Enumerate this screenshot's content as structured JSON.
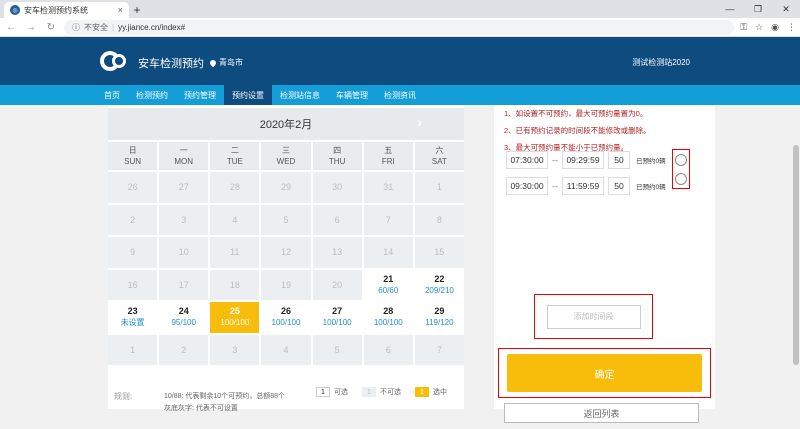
{
  "browser": {
    "tab_title": "安车检测预约系统",
    "tab_close": "×",
    "new_tab": "+",
    "security": "不安全",
    "url": "yy.jiance.cn/index#"
  },
  "header": {
    "site_title": "安车检测预约",
    "city": "青岛市",
    "station": "测试检测站2020"
  },
  "nav": [
    {
      "label": "首页"
    },
    {
      "label": "检测预约"
    },
    {
      "label": "预约管理"
    },
    {
      "label": "预约设置",
      "active": true
    },
    {
      "label": "检测站信息"
    },
    {
      "label": "车辆管理"
    },
    {
      "label": "检测资讯"
    }
  ],
  "calendar": {
    "month_title": "2020年2月",
    "next_arrow": "›",
    "weekdays": [
      {
        "cn": "日",
        "en": "SUN"
      },
      {
        "cn": "一",
        "en": "MON"
      },
      {
        "cn": "二",
        "en": "TUE"
      },
      {
        "cn": "三",
        "en": "WED"
      },
      {
        "cn": "四",
        "en": "THU"
      },
      {
        "cn": "五",
        "en": "FRI"
      },
      {
        "cn": "六",
        "en": "SAT"
      }
    ],
    "days": [
      {
        "d": "26",
        "s": "",
        "t": "other"
      },
      {
        "d": "27",
        "s": "",
        "t": "other"
      },
      {
        "d": "28",
        "s": "",
        "t": "other"
      },
      {
        "d": "29",
        "s": "",
        "t": "other"
      },
      {
        "d": "30",
        "s": "",
        "t": "other"
      },
      {
        "d": "31",
        "s": "",
        "t": "other"
      },
      {
        "d": "1",
        "s": "",
        "t": "other"
      },
      {
        "d": "2",
        "s": "",
        "t": "other"
      },
      {
        "d": "3",
        "s": "",
        "t": "other"
      },
      {
        "d": "4",
        "s": "",
        "t": "other"
      },
      {
        "d": "5",
        "s": "",
        "t": "other"
      },
      {
        "d": "6",
        "s": "",
        "t": "other"
      },
      {
        "d": "7",
        "s": "",
        "t": "other"
      },
      {
        "d": "8",
        "s": "",
        "t": "other"
      },
      {
        "d": "9",
        "s": "",
        "t": "other"
      },
      {
        "d": "10",
        "s": "",
        "t": "other"
      },
      {
        "d": "11",
        "s": "",
        "t": "other"
      },
      {
        "d": "12",
        "s": "",
        "t": "other"
      },
      {
        "d": "13",
        "s": "",
        "t": "other"
      },
      {
        "d": "14",
        "s": "",
        "t": "other"
      },
      {
        "d": "15",
        "s": "",
        "t": "other"
      },
      {
        "d": "16",
        "s": "",
        "t": "other"
      },
      {
        "d": "17",
        "s": "",
        "t": "other"
      },
      {
        "d": "18",
        "s": "",
        "t": "other"
      },
      {
        "d": "19",
        "s": "",
        "t": "other"
      },
      {
        "d": "20",
        "s": "",
        "t": "other"
      },
      {
        "d": "21",
        "s": "60/60",
        "t": "cur"
      },
      {
        "d": "22",
        "s": "209/210",
        "t": "cur"
      },
      {
        "d": "23",
        "s": "未设置",
        "t": "cur"
      },
      {
        "d": "24",
        "s": "95/100",
        "t": "cur"
      },
      {
        "d": "25",
        "s": "100/100",
        "t": "sel"
      },
      {
        "d": "26",
        "s": "100/100",
        "t": "cur"
      },
      {
        "d": "27",
        "s": "100/100",
        "t": "cur"
      },
      {
        "d": "28",
        "s": "100/100",
        "t": "cur"
      },
      {
        "d": "29",
        "s": "119/120",
        "t": "cur"
      },
      {
        "d": "1",
        "s": "",
        "t": "other"
      },
      {
        "d": "2",
        "s": "",
        "t": "other"
      },
      {
        "d": "3",
        "s": "",
        "t": "other"
      },
      {
        "d": "4",
        "s": "",
        "t": "other"
      },
      {
        "d": "5",
        "s": "",
        "t": "other"
      },
      {
        "d": "6",
        "s": "",
        "t": "other"
      },
      {
        "d": "7",
        "s": "",
        "t": "other"
      }
    ]
  },
  "legend": {
    "rule": "规则:",
    "line1": "10/88: 代表剩余10个可预约，总额88个",
    "line2": "灰底灰字: 代表不可设置",
    "items": [
      {
        "num": "1",
        "label": "可选",
        "style": "a"
      },
      {
        "num": "1",
        "label": "不可选",
        "style": "b"
      },
      {
        "num": "1",
        "label": "选中",
        "style": "c"
      }
    ]
  },
  "panel": {
    "notes": [
      "1、如设置不可预约，最大可预约量置为0。",
      "2、已有预约记录的时间段不能修改或删除。",
      "3、最大可预约量不能小于已预约量。"
    ],
    "slots": [
      {
        "start": "07:30:00",
        "end": "09:29:59",
        "max": "50",
        "booked": "已预约0辆"
      },
      {
        "start": "09:30:00",
        "end": "11:59:59",
        "max": "50",
        "booked": "已预约0辆"
      }
    ],
    "range_sep": "--",
    "add_label": "添加时间段",
    "confirm_label": "确定",
    "back_label": "返回列表"
  }
}
